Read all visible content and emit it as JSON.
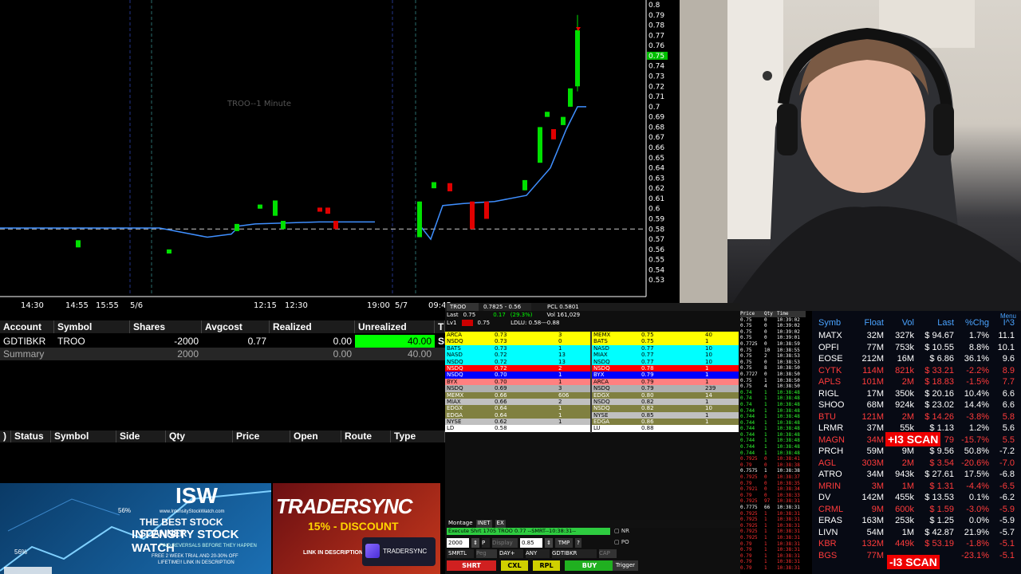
{
  "chart": {
    "title": "TROO--1 Minute",
    "price_labels": [
      "0.8",
      "0.79",
      "0.78",
      "0.77",
      "0.76",
      "0.75",
      "0.74",
      "0.73",
      "0.72",
      "0.71",
      "0.7",
      "0.69",
      "0.68",
      "0.67",
      "0.66",
      "0.65",
      "0.64",
      "0.63",
      "0.62",
      "0.61",
      "0.6",
      "0.59",
      "0.58",
      "0.57",
      "0.56",
      "0.55",
      "0.54",
      "0.53"
    ],
    "current_price": "0.75",
    "time_labels": [
      "14:30",
      "14:55",
      "15:55",
      "5/6",
      "12:15",
      "12:30",
      "19:00",
      "5/7",
      "09:45"
    ]
  },
  "positions": {
    "headers": [
      "Account",
      "Symbol",
      "Shares",
      "Avgcost",
      "Realized",
      "Unrealized",
      "T"
    ],
    "row": {
      "account": "GDTIBKR",
      "symbol": "TROO",
      "shares": "-2000",
      "avgcost": "0.77",
      "realized": "0.00",
      "unrealized": "40.00",
      "extra": "SI"
    },
    "summary": {
      "label": "Summary",
      "shares": "2000",
      "realized": "0.00",
      "unrealized": "40.00"
    }
  },
  "orders": {
    "headers": [
      ")",
      "Status",
      "Symbol",
      "Side",
      "Qty",
      "Price",
      "Open",
      "Route",
      "Type"
    ]
  },
  "ads": {
    "isw": {
      "brand": "ISW",
      "site": "www.IntensityStockWatch.com",
      "line1": "THE BEST STOCK SCANNER",
      "line2": "INTENSITY STOCK WATCH",
      "line3": "FIND REVERSALS BEFORE THEY HAPPEN",
      "line4": "FREE 2 WEEK TRIAL AND 20-30% OFF",
      "line5": "LIFETIME!! LINK IN DESCRIPTION",
      "pct1": "56%",
      "pct2": "56%"
    },
    "ts": {
      "brand": "TRADERSYNC",
      "discount": "15% - DISCOUNT",
      "link": "LINK IN DESCRIPTION",
      "logo": "TRADERSYNC"
    }
  },
  "level2": {
    "symbol": "TROO",
    "bid_ask": "0.7825 - 0.56",
    "pcl": "PCL  0.5801",
    "last_label": "Last",
    "last": "0.75",
    "chg": "0.17",
    "chg_pct": "(29.3%)",
    "vol": "Vol  161,029",
    "lv1": "Lv1",
    "lv1_val": "0.75",
    "ludu": "LDLU: 0.58---0.88",
    "bids": [
      {
        "mm": "ARCA",
        "px": "0.73",
        "sz": "3",
        "c": "#ffff00",
        "t": "#000"
      },
      {
        "mm": "NSDQ",
        "px": "0.73",
        "sz": "0",
        "c": "#ffff00",
        "t": "#000"
      },
      {
        "mm": "BATS",
        "px": "0.73",
        "sz": "1",
        "c": "#00ffff",
        "t": "#000"
      },
      {
        "mm": "NASD",
        "px": "0.72",
        "sz": "13",
        "c": "#00ffff",
        "t": "#000"
      },
      {
        "mm": "NSDQ",
        "px": "0.72",
        "sz": "13",
        "c": "#00ffff",
        "t": "#000"
      },
      {
        "mm": "NSDQ",
        "px": "0.72",
        "sz": "2",
        "c": "#ff0000",
        "t": "#fff"
      },
      {
        "mm": "NSDQ",
        "px": "0.70",
        "sz": "1",
        "c": "#0000ff",
        "t": "#fff"
      },
      {
        "mm": "BYX",
        "px": "0.70",
        "sz": "1",
        "c": "#ff8080",
        "t": "#000"
      },
      {
        "mm": "NSDQ",
        "px": "0.69",
        "sz": "3",
        "c": "#b0b0b0",
        "t": "#000"
      },
      {
        "mm": "MEMX",
        "px": "0.66",
        "sz": "606",
        "c": "#808040",
        "t": "#fff"
      },
      {
        "mm": "MIAX",
        "px": "0.66",
        "sz": "2",
        "c": "#c0c0c0",
        "t": "#000"
      },
      {
        "mm": "EDGX",
        "px": "0.64",
        "sz": "1",
        "c": "#808040",
        "t": "#fff"
      },
      {
        "mm": "EDGA",
        "px": "0.64",
        "sz": "1",
        "c": "#808040",
        "t": "#fff"
      },
      {
        "mm": "NYSE",
        "px": "0.62",
        "sz": "1",
        "c": "#c0c0c0",
        "t": "#000"
      },
      {
        "mm": "LD",
        "px": "0.58",
        "sz": "",
        "c": "#ffffff",
        "t": "#000"
      }
    ],
    "asks": [
      {
        "mm": "MEMX",
        "px": "0.75",
        "sz": "40",
        "c": "#ffff00",
        "t": "#000"
      },
      {
        "mm": "BATS",
        "px": "0.75",
        "sz": "1",
        "c": "#ffff00",
        "t": "#000"
      },
      {
        "mm": "NASD",
        "px": "0.77",
        "sz": "10",
        "c": "#00ffff",
        "t": "#000"
      },
      {
        "mm": "MIAX",
        "px": "0.77",
        "sz": "10",
        "c": "#00ffff",
        "t": "#000"
      },
      {
        "mm": "NSDQ",
        "px": "0.77",
        "sz": "10",
        "c": "#00ffff",
        "t": "#000"
      },
      {
        "mm": "NSDQ",
        "px": "0.78",
        "sz": "1",
        "c": "#ff0000",
        "t": "#fff"
      },
      {
        "mm": "BYX",
        "px": "0.79",
        "sz": "1",
        "c": "#0000ff",
        "t": "#fff"
      },
      {
        "mm": "ARCA",
        "px": "0.79",
        "sz": "1",
        "c": "#ff8080",
        "t": "#000"
      },
      {
        "mm": "NSDQ",
        "px": "0.79",
        "sz": "239",
        "c": "#b0b0b0",
        "t": "#000"
      },
      {
        "mm": "EDGX",
        "px": "0.80",
        "sz": "14",
        "c": "#808040",
        "t": "#fff"
      },
      {
        "mm": "NSDQ",
        "px": "0.82",
        "sz": "1",
        "c": "#c0c0c0",
        "t": "#000"
      },
      {
        "mm": "NSDQ",
        "px": "0.82",
        "sz": "10",
        "c": "#808040",
        "t": "#fff"
      },
      {
        "mm": "NYSE",
        "px": "0.85",
        "sz": "1",
        "c": "#c0c0c0",
        "t": "#000"
      },
      {
        "mm": "EDGA",
        "px": "0.86",
        "sz": "1",
        "c": "#808040",
        "t": "#fff"
      },
      {
        "mm": "LU",
        "px": "0.88",
        "sz": "",
        "c": "#ffffff",
        "t": "#000"
      }
    ],
    "montage_label": "Montage",
    "montage_tabs": [
      "INET",
      "EX"
    ],
    "exec_msg": "Execute Shrt 1705 TROO 0.77 --SMRT--10:38:31--",
    "qty": "2000",
    "p_label": "P",
    "display": "Display",
    "price": "0.85",
    "tmp": "TMP",
    "q": "?",
    "nr": "NR",
    "po": "PO",
    "route": "SMRTL",
    "peg": "Peg",
    "tif": "DAY+",
    "any": "ANY",
    "account": "GDTIBKR",
    "cap": "CAP",
    "btn_short": "SHRT",
    "btn_cxl": "CXL",
    "btn_rpl": "RPL",
    "btn_buy": "BUY",
    "btn_trigger": "Trigger"
  },
  "tns": {
    "headers": [
      "Price",
      "Qty",
      "Time"
    ],
    "rows": [
      [
        "0.75",
        "0",
        "10:39:02"
      ],
      [
        "0.75",
        "0",
        "10:39:02"
      ],
      [
        "0.75",
        "0",
        "10:39:02"
      ],
      [
        "0.75",
        "0",
        "10:39:01"
      ],
      [
        "0.7725",
        "0",
        "10:38:59"
      ],
      [
        "0.75",
        "10",
        "10:38:55"
      ],
      [
        "0.75",
        "2",
        "10:38:53"
      ],
      [
        "0.75",
        "0",
        "10:38:53"
      ],
      [
        "0.75",
        "8",
        "10:38:50"
      ],
      [
        "0.7727",
        "0",
        "10:38:50"
      ],
      [
        "0.75",
        "1",
        "10:38:50"
      ],
      [
        "0.75",
        "4",
        "10:38:50"
      ],
      [
        "0.74",
        "1",
        "10:38:48"
      ],
      [
        "0.74",
        "1",
        "10:38:48"
      ],
      [
        "0.74",
        "1",
        "10:38:48"
      ],
      [
        "0.744",
        "1",
        "10:38:48"
      ],
      [
        "0.744",
        "1",
        "10:38:48"
      ],
      [
        "0.744",
        "1",
        "10:38:48"
      ],
      [
        "0.744",
        "1",
        "10:38:48"
      ],
      [
        "0.744",
        "1",
        "10:38:48"
      ],
      [
        "0.744",
        "1",
        "10:38:48"
      ],
      [
        "0.744",
        "1",
        "10:38:48"
      ],
      [
        "0.744",
        "1",
        "10:38:48"
      ],
      [
        "0.7925",
        "0",
        "10:38:41"
      ],
      [
        "0.79",
        "0",
        "10:38:38"
      ],
      [
        "0.7575",
        "1",
        "10:38:38"
      ],
      [
        "0.7925",
        "0",
        "10:38:37"
      ],
      [
        "0.79",
        "0",
        "10:38:35"
      ],
      [
        "0.7921",
        "0",
        "10:38:34"
      ],
      [
        "0.79",
        "0",
        "10:38:33"
      ],
      [
        "0.7925",
        "97",
        "10:38:31"
      ],
      [
        "0.7775",
        "66",
        "10:38:31"
      ],
      [
        "0.7925",
        "1",
        "10:38:31"
      ],
      [
        "0.7925",
        "1",
        "10:38:31"
      ],
      [
        "0.7925",
        "1",
        "10:38:31"
      ],
      [
        "0.7925",
        "1",
        "10:38:31"
      ],
      [
        "0.7925",
        "1",
        "10:38:31"
      ],
      [
        "0.79",
        "1",
        "10:38:31"
      ],
      [
        "0.79",
        "1",
        "10:38:31"
      ],
      [
        "0.79",
        "1",
        "10:38:31"
      ],
      [
        "0.79",
        "1",
        "10:38:31"
      ],
      [
        "0.79",
        "1",
        "10:38:31"
      ]
    ]
  },
  "scanner": {
    "menu": "Menu",
    "headers": [
      "Symb",
      "Float",
      "Vol",
      "Last",
      "%Chg",
      "I^3"
    ],
    "badge": "+I3 SCAN",
    "badge2": "-I3 SCAN",
    "rows": [
      {
        "s": "MATX",
        "f": "32M",
        "v": "327k",
        "l": "$ 94.67",
        "p": "1.7%",
        "i": "11.1",
        "c": "#ffffff"
      },
      {
        "s": "OPFI",
        "f": "77M",
        "v": "753k",
        "l": "$ 10.55",
        "p": "8.8%",
        "i": "10.1",
        "c": "#ffffff"
      },
      {
        "s": "EOSE",
        "f": "212M",
        "v": "16M",
        "l": "$ 6.86",
        "p": "36.1%",
        "i": "9.6",
        "c": "#ffffff"
      },
      {
        "s": "CYTK",
        "f": "114M",
        "v": "821k",
        "l": "$ 33.21",
        "p": "-2.2%",
        "i": "8.9",
        "c": "#ff3b3b"
      },
      {
        "s": "APLS",
        "f": "101M",
        "v": "2M",
        "l": "$ 18.83",
        "p": "-1.5%",
        "i": "7.7",
        "c": "#ff3b3b"
      },
      {
        "s": "RIGL",
        "f": "17M",
        "v": "350k",
        "l": "$ 20.16",
        "p": "10.4%",
        "i": "6.6",
        "c": "#ffffff"
      },
      {
        "s": "SHOO",
        "f": "68M",
        "v": "924k",
        "l": "$ 23.02",
        "p": "14.4%",
        "i": "6.6",
        "c": "#ffffff"
      },
      {
        "s": "BTU",
        "f": "121M",
        "v": "2M",
        "l": "$ 14.26",
        "p": "-3.8%",
        "i": "5.8",
        "c": "#ff3b3b"
      },
      {
        "s": "LRMR",
        "f": "37M",
        "v": "55k",
        "l": "$ 1.13",
        "p": "1.2%",
        "i": "5.6",
        "c": "#ffffff"
      },
      {
        "s": "MAGN",
        "f": "34M",
        "v": "",
        "l": "79",
        "p": "-15.7%",
        "i": "5.5",
        "c": "#ff3b3b"
      },
      {
        "s": "PRCH",
        "f": "59M",
        "v": "9M",
        "l": "$ 9.56",
        "p": "50.8%",
        "i": "-7.2",
        "c": "#ffffff"
      },
      {
        "s": "AGL",
        "f": "303M",
        "v": "2M",
        "l": "$ 3.54",
        "p": "-20.6%",
        "i": "-7.0",
        "c": "#ff3b3b"
      },
      {
        "s": "ATRO",
        "f": "34M",
        "v": "943k",
        "l": "$ 27.61",
        "p": "17.5%",
        "i": "-6.8",
        "c": "#ffffff"
      },
      {
        "s": "MRIN",
        "f": "3M",
        "v": "1M",
        "l": "$ 1.31",
        "p": "-4.4%",
        "i": "-6.5",
        "c": "#ff3b3b"
      },
      {
        "s": "DV",
        "f": "142M",
        "v": "455k",
        "l": "$ 13.53",
        "p": "0.1%",
        "i": "-6.2",
        "c": "#ffffff"
      },
      {
        "s": "CRML",
        "f": "9M",
        "v": "600k",
        "l": "$ 1.59",
        "p": "-3.0%",
        "i": "-5.9",
        "c": "#ff3b3b"
      },
      {
        "s": "ERAS",
        "f": "163M",
        "v": "253k",
        "l": "$ 1.25",
        "p": "0.0%",
        "i": "-5.9",
        "c": "#ffffff"
      },
      {
        "s": "LIVN",
        "f": "54M",
        "v": "1M",
        "l": "$ 42.87",
        "p": "21.9%",
        "i": "-5.7",
        "c": "#ffffff"
      },
      {
        "s": "KBR",
        "f": "132M",
        "v": "449k",
        "l": "$ 53.19",
        "p": "-1.8%",
        "i": "-5.1",
        "c": "#ff3b3b"
      },
      {
        "s": "BGS",
        "f": "77M",
        "v": "",
        "l": "",
        "p": "-23.1%",
        "i": "-5.1",
        "c": "#ff3b3b"
      }
    ]
  }
}
